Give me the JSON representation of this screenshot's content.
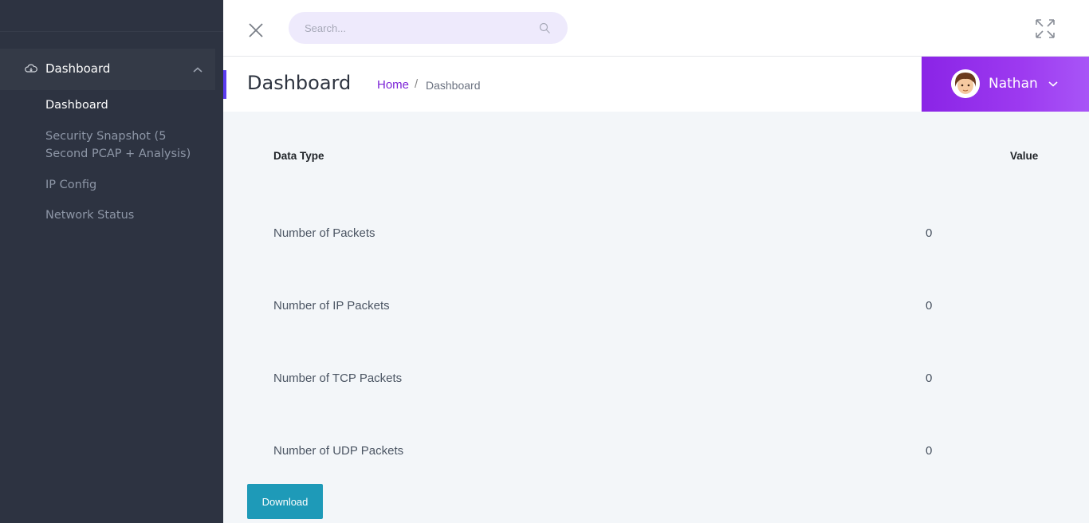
{
  "sidebar": {
    "group": {
      "label": "Dashboard",
      "icon": "cloud-icon",
      "expanded": true
    },
    "items": [
      {
        "label": "Dashboard",
        "active": true
      },
      {
        "label": "Security Snapshot (5 Second PCAP + Analysis)",
        "active": false
      },
      {
        "label": "IP Config",
        "active": false
      },
      {
        "label": "Network Status",
        "active": false
      }
    ]
  },
  "header": {
    "search": {
      "placeholder": "Search..."
    },
    "user": {
      "name": "Nathan"
    }
  },
  "page": {
    "title": "Dashboard",
    "breadcrumb": {
      "home": "Home",
      "separator": "/",
      "current": "Dashboard"
    }
  },
  "table": {
    "headers": {
      "type": "Data Type",
      "value": "Value"
    },
    "rows": [
      {
        "label": "Number of Packets",
        "value": "0"
      },
      {
        "label": "Number of IP Packets",
        "value": "0"
      },
      {
        "label": "Number of TCP Packets",
        "value": "0"
      },
      {
        "label": "Number of UDP Packets",
        "value": "0"
      }
    ]
  },
  "actions": {
    "download_label": "Download"
  },
  "colors": {
    "sidebar_bg": "#2d3341",
    "accent_purple": "#8a24e6",
    "breadcrumb_link": "#7b23d6",
    "download_button": "#1e9ab8"
  }
}
